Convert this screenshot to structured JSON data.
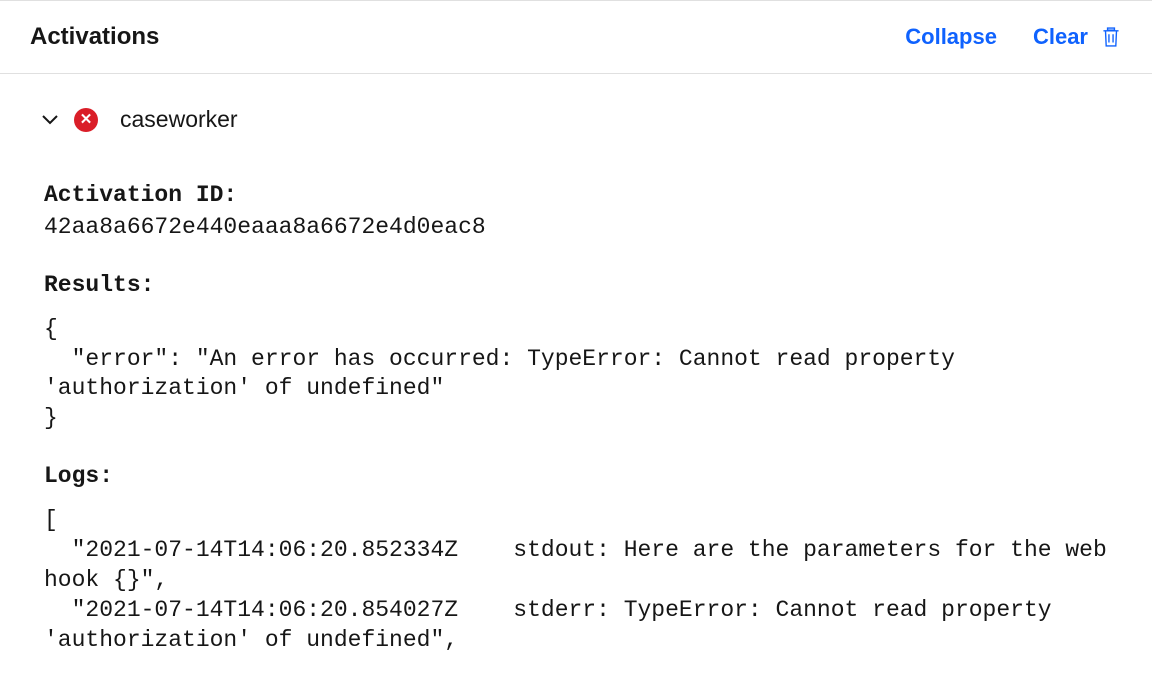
{
  "header": {
    "title": "Activations",
    "collapse_label": "Collapse",
    "clear_label": "Clear"
  },
  "activation": {
    "name": "caseworker",
    "id_label": "Activation ID:",
    "id_value": "42aa8a6672e440eaaa8a6672e4d0eac8",
    "results_label": "Results:",
    "results_body": "{\n  \"error\": \"An error has occurred: TypeError: Cannot read property 'authorization' of undefined\"\n}",
    "logs_label": "Logs:",
    "logs_body": "[\n  \"2021-07-14T14:06:20.852334Z    stdout: Here are the parameters for the web hook {}\",\n  \"2021-07-14T14:06:20.854027Z    stderr: TypeError: Cannot read property 'authorization' of undefined\","
  },
  "colors": {
    "link": "#0f62fe",
    "error": "#da1e28"
  }
}
